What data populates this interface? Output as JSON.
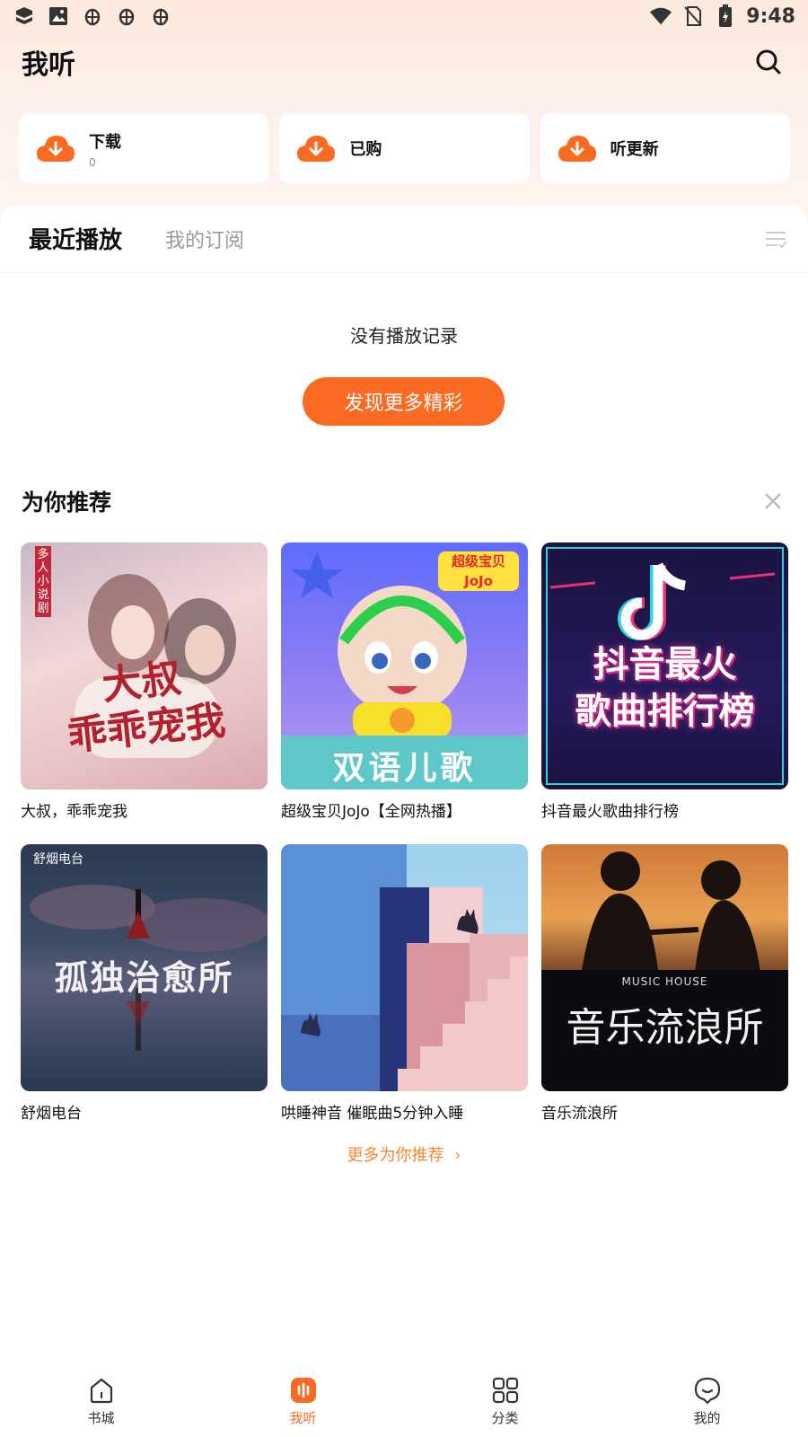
{
  "status_bar": {
    "time": "9:48",
    "icons": [
      "app-icon",
      "image-icon",
      "bug-icon",
      "bug-icon",
      "bug-icon",
      "wifi-icon",
      "no-sim-icon",
      "battery-charging-icon"
    ]
  },
  "header": {
    "title": "我听",
    "search_icon": "search-icon"
  },
  "quick_actions": [
    {
      "label": "下载",
      "sub": "0",
      "icon": "cloud-download-icon"
    },
    {
      "label": "已购",
      "sub": "",
      "icon": "cloud-download-icon"
    },
    {
      "label": "听更新",
      "sub": "",
      "icon": "cloud-download-icon"
    }
  ],
  "tabs": [
    {
      "label": "最近播放",
      "active": true
    },
    {
      "label": "我的订阅",
      "active": false
    }
  ],
  "empty_state": {
    "message": "没有播放记录",
    "button_label": "发现更多精彩"
  },
  "recommend": {
    "title": "为你推荐",
    "items": [
      {
        "title": "大叔，乖乖宠我",
        "cover_text": "大叔\n乖乖宠我",
        "badge": "多人小说剧"
      },
      {
        "title": "超级宝贝JoJo【全网热播】",
        "cover_text": "双语儿歌",
        "badge": "超级宝贝 JoJo"
      },
      {
        "title": "抖音最火歌曲排行榜",
        "cover_text": "抖音最火\n歌曲排行榜",
        "badge": ""
      },
      {
        "title": "舒烟电台",
        "cover_text": "孤独治愈所",
        "badge": "舒烟电台"
      },
      {
        "title": "哄睡神音 催眠曲5分钟入睡",
        "cover_text": "",
        "badge": ""
      },
      {
        "title": "音乐流浪所",
        "cover_text": "音乐流浪所",
        "badge": "MUSIC HOUSE"
      }
    ],
    "more_label": "更多为你推荐"
  },
  "bottom_nav": [
    {
      "label": "书城",
      "icon": "home-icon",
      "active": false
    },
    {
      "label": "我听",
      "icon": "listen-icon",
      "active": true
    },
    {
      "label": "分类",
      "icon": "grid-icon",
      "active": false
    },
    {
      "label": "我的",
      "icon": "profile-icon",
      "active": false
    }
  ],
  "colors": {
    "accent": "#fb6a22",
    "more_link": "#f28a2e"
  }
}
